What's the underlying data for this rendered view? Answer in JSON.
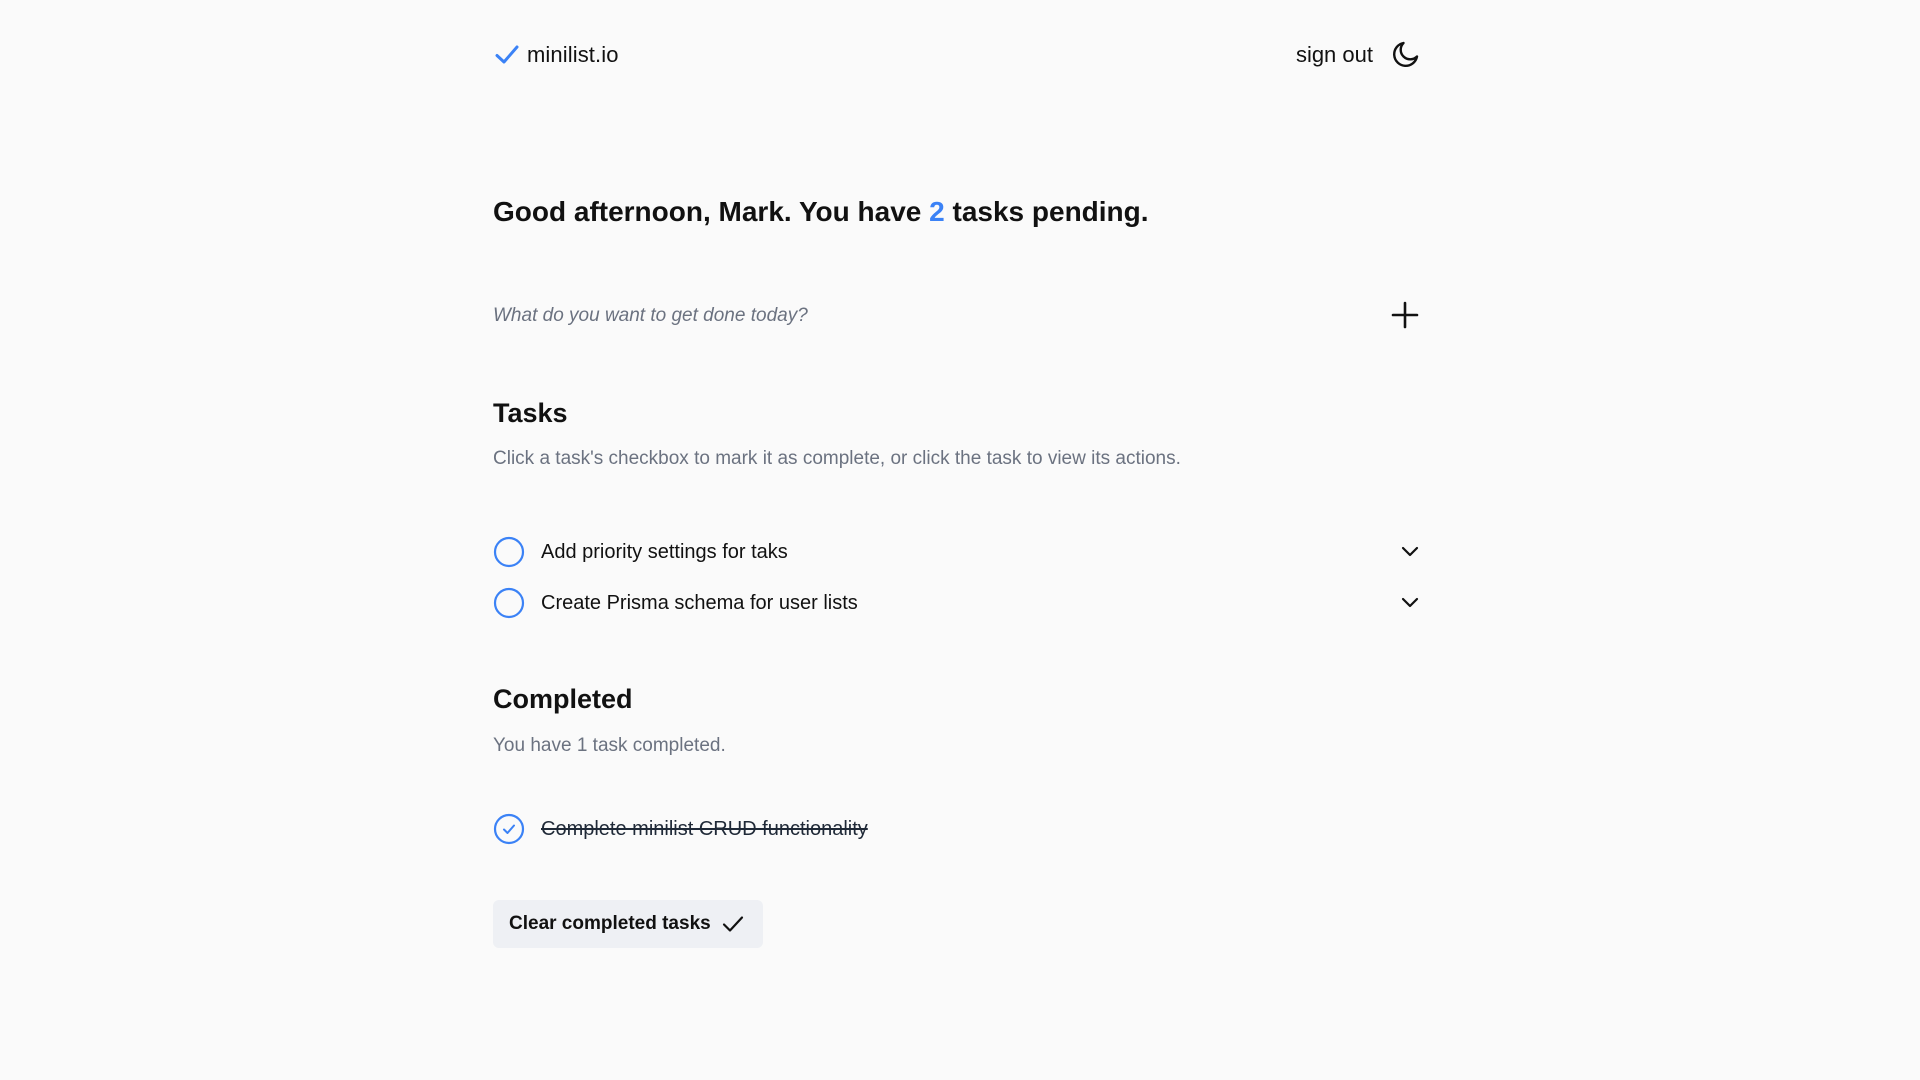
{
  "header": {
    "brand": "minilist.io",
    "sign_out_label": "sign out",
    "theme_icon": "moon-icon",
    "brand_icon": "check-icon",
    "accent_color": "#3b82f6"
  },
  "greeting": {
    "prefix": "Good afternoon, Mark. You have ",
    "pending_count": "2",
    "suffix": " tasks pending."
  },
  "new_task": {
    "placeholder": "What do you want to get done today?",
    "value": "",
    "add_icon": "plus-icon"
  },
  "tasks": {
    "title": "Tasks",
    "description": "Click a task's checkbox to mark it as complete, or click the task to view its actions.",
    "items": [
      {
        "label": "Add priority settings for taks",
        "completed": false
      },
      {
        "label": "Create Prisma schema for user lists",
        "completed": false
      }
    ]
  },
  "completed": {
    "title": "Completed",
    "description": "You have 1 task completed.",
    "items": [
      {
        "label": "Complete minilist CRUD functionality",
        "completed": true
      }
    ],
    "clear_label": "Clear completed tasks"
  }
}
